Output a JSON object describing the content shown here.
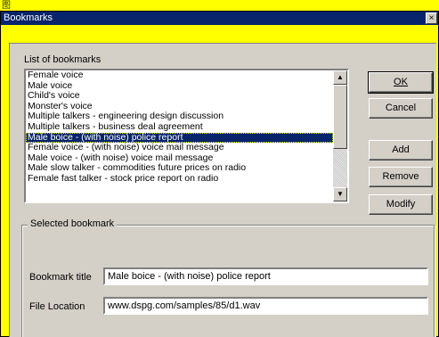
{
  "window": {
    "title": "Bookmarks",
    "close_glyph": "×",
    "top_glyph": "图"
  },
  "list": {
    "label": "List of bookmarks",
    "items": [
      "Female voice",
      "Male voice",
      "Child's voice",
      "Monster's voice",
      "Multiple talkers - engineering design discussion",
      "Multiple talkers - business deal agreement",
      "Male boice - (with noise) police report",
      "Female voice - (with noise) voice mail message",
      "Male voice - (with noise) voice mail message",
      "Male slow talker - commodities future prices on radio",
      "Female fast talker - stock price report on radio"
    ],
    "selected_index": 6
  },
  "buttons": {
    "ok": "OK",
    "cancel": "Cancel",
    "add": "Add",
    "remove": "Remove",
    "modify": "Modify"
  },
  "selected": {
    "group_label": "Selected bookmark",
    "title_label": "Bookmark title",
    "title_value": "Male boice - (with noise) police report",
    "location_label": "File Location",
    "location_value": "www.dspg.com/samples/85/d1.wav"
  },
  "icons": {
    "scroll_up": "up-arrow-icon",
    "scroll_down": "down-arrow-icon",
    "close": "close-icon"
  },
  "colors": {
    "title_bar": "#08246b",
    "selection": "#08246b",
    "face": "#d4d0c8",
    "background": "#ffff00"
  }
}
